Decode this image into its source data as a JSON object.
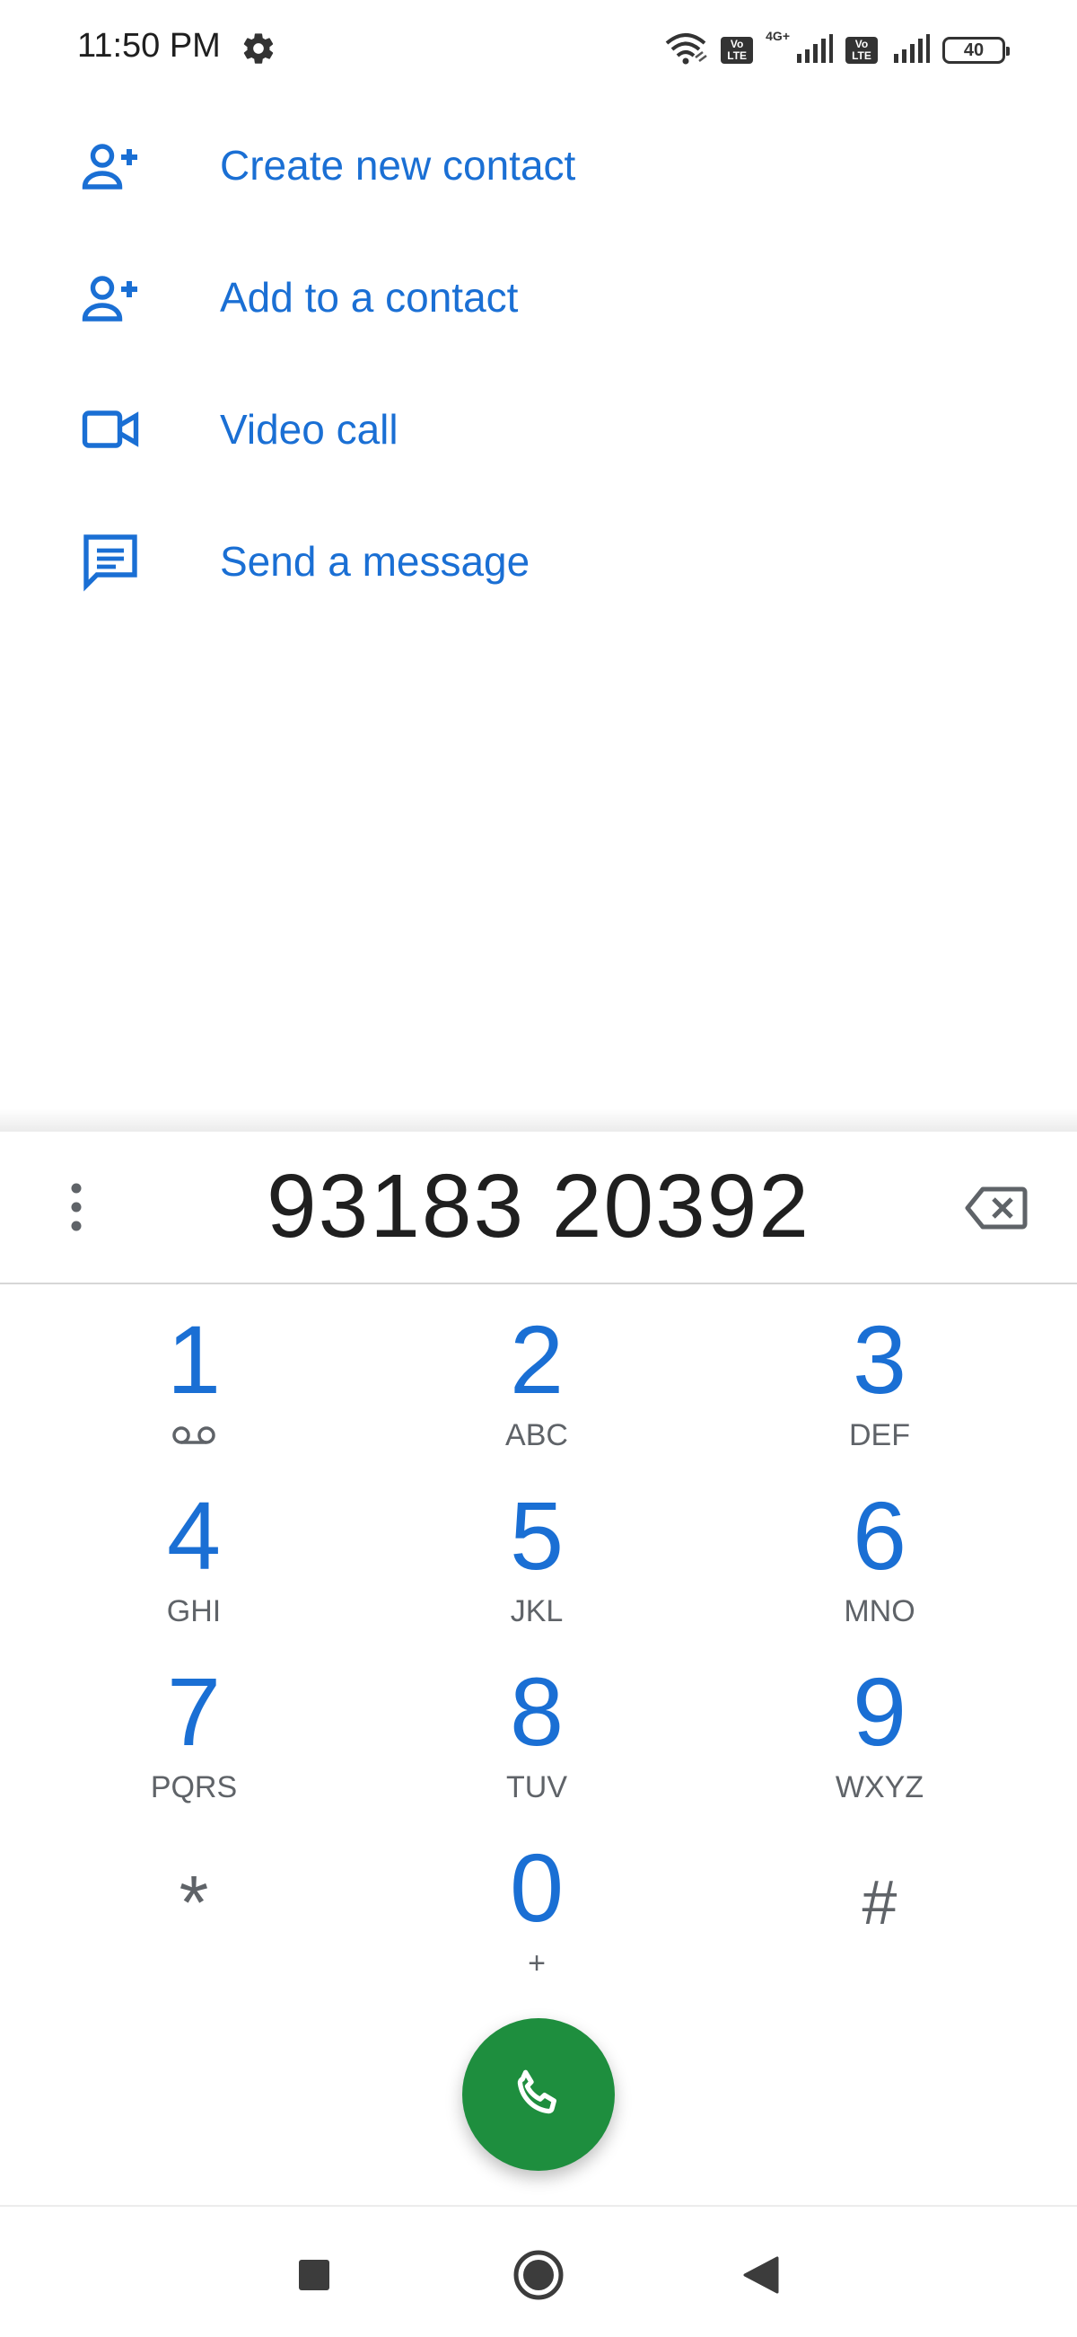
{
  "status_bar": {
    "time": "11:50 PM",
    "icons": [
      "gear-icon",
      "wifi-icon",
      "volte-icon",
      "signal-icon",
      "volte-icon",
      "signal-icon",
      "battery-icon"
    ],
    "volte_label_top": "Vo",
    "volte_label_bottom": "LTE",
    "network_type": "4G+",
    "battery_level": "40"
  },
  "actions": [
    {
      "label": "Create new contact",
      "icon": "add-person-icon"
    },
    {
      "label": "Add to a contact",
      "icon": "add-person-icon"
    },
    {
      "label": "Video call",
      "icon": "video-icon"
    },
    {
      "label": "Send a message",
      "icon": "message-icon"
    }
  ],
  "dialer": {
    "number": "93183 20392",
    "keys": [
      {
        "digit": "1",
        "letters": ""
      },
      {
        "digit": "2",
        "letters": "ABC"
      },
      {
        "digit": "3",
        "letters": "DEF"
      },
      {
        "digit": "4",
        "letters": "GHI"
      },
      {
        "digit": "5",
        "letters": "JKL"
      },
      {
        "digit": "6",
        "letters": "MNO"
      },
      {
        "digit": "7",
        "letters": "PQRS"
      },
      {
        "digit": "8",
        "letters": "TUV"
      },
      {
        "digit": "9",
        "letters": "WXYZ"
      },
      {
        "digit": "*",
        "letters": ""
      },
      {
        "digit": "0",
        "letters": "+"
      },
      {
        "digit": "#",
        "letters": ""
      }
    ]
  },
  "colors": {
    "accent": "#1a6fd4",
    "call_button": "#1e8e3e",
    "secondary_text": "#5f6368"
  }
}
